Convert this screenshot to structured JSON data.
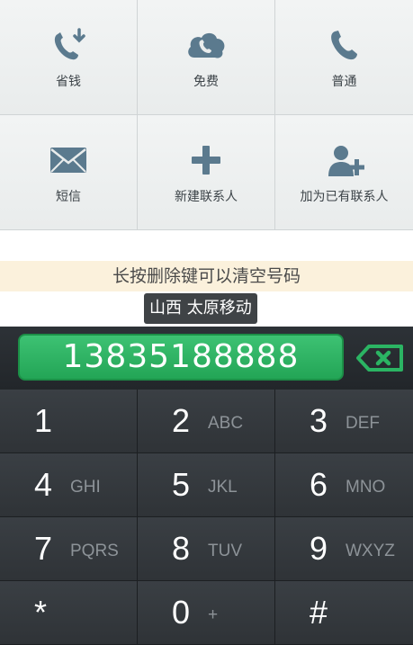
{
  "actions": [
    {
      "label": "省钱",
      "icon": "phone-down-arrow-icon"
    },
    {
      "label": "免费",
      "icon": "cloud-phone-icon"
    },
    {
      "label": "普通",
      "icon": "phone-icon"
    },
    {
      "label": "短信",
      "icon": "envelope-icon"
    },
    {
      "label": "新建联系人",
      "icon": "plus-icon"
    },
    {
      "label": "加为已有联系人",
      "icon": "add-contact-icon"
    }
  ],
  "hint": "长按删除键可以清空号码",
  "location": "山西 太原移动",
  "dialed_number": "13835188888",
  "keys": [
    {
      "digit": "1",
      "letters": ""
    },
    {
      "digit": "2",
      "letters": "ABC"
    },
    {
      "digit": "3",
      "letters": "DEF"
    },
    {
      "digit": "4",
      "letters": "GHI"
    },
    {
      "digit": "5",
      "letters": "JKL"
    },
    {
      "digit": "6",
      "letters": "MNO"
    },
    {
      "digit": "7",
      "letters": "PQRS"
    },
    {
      "digit": "8",
      "letters": "TUV"
    },
    {
      "digit": "9",
      "letters": "WXYZ"
    },
    {
      "digit": "*",
      "letters": ""
    },
    {
      "digit": "0",
      "letters": "+"
    },
    {
      "digit": "#",
      "letters": ""
    }
  ],
  "colors": {
    "accent_green": "#2bb463",
    "keypad_bg": "#2f3337",
    "hint_bg": "#fbf1dc"
  }
}
